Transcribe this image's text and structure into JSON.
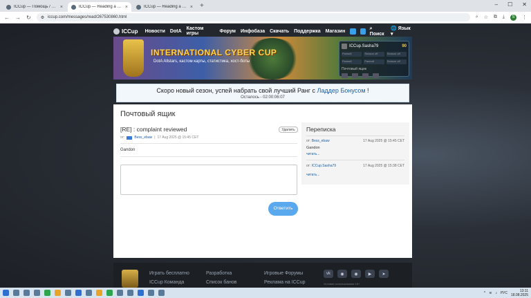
{
  "browser": {
    "tabs": [
      {
        "title": "ICCup — Помощь / 31-июля/"
      },
      {
        "title": "ICCup — Reading a message f"
      },
      {
        "title": "ICCup — Reading a message f"
      }
    ],
    "url": "iccup.com/messages/read/267530860.html",
    "profile_initial": "S"
  },
  "sitenav": {
    "logo": "ICCup",
    "items": [
      "Новости",
      "DotA",
      "Кастом игры",
      "Форум",
      "Инфобаза",
      "Скачать",
      "Поддержка",
      "Магазин"
    ],
    "search": "Поиск",
    "language": "Язык"
  },
  "banner": {
    "title": "INTERNATIONAL CYBER CUP",
    "subtitle": "DotA Allstars, кастом карты, статистика, хост-боты",
    "user": {
      "name": "ICCup.Sasha79",
      "gold": "90",
      "f1": "Ранний",
      "f2": "Season off",
      "f3": "Season off",
      "f4": "Ранний",
      "f5": "Ранний",
      "f6": "Season off",
      "pm": "Почтовый ящик"
    }
  },
  "notice": {
    "text": "Скоро новый сезон, успей набрать свой лучший Ранг с",
    "link": "Ладдер Бонусом",
    "after": "!",
    "timer": "Осталось - 02:00:06:07"
  },
  "page": {
    "title": "Почтовый ящик",
    "message": {
      "title": "[RE] : complaint reviewed",
      "delete": "Удалить",
      "from_label": "от:",
      "from": "Bess_ebaw",
      "date": "17 Aug 2025 @ 15:45 CET",
      "body": "Gandon"
    },
    "send": "Ответить"
  },
  "sidebar": {
    "title": "Переписка",
    "items": [
      {
        "from_label": "от:",
        "from": "Bess_ebaw",
        "date": "17 Aug 2025 @ 15:45 CET",
        "text": "Gandon",
        "read": "читать..."
      },
      {
        "from_label": "от:",
        "from": "ICCup.Sasha79",
        "date": "17 Aug 2025 @ 15:38 CET",
        "text": "",
        "read": "читать..."
      }
    ]
  },
  "footer": {
    "col1": [
      "Играть бесплатно",
      "ICCup Команда"
    ],
    "col2": [
      "Разработка",
      "Список банов"
    ],
    "col3": [
      "Игровые Форумы",
      "Реклама на ICCup"
    ],
    "note": "Условия использования 18+"
  },
  "taskbar": {
    "lang": "РУС",
    "time": "13:11",
    "date": "18.08.2025"
  }
}
